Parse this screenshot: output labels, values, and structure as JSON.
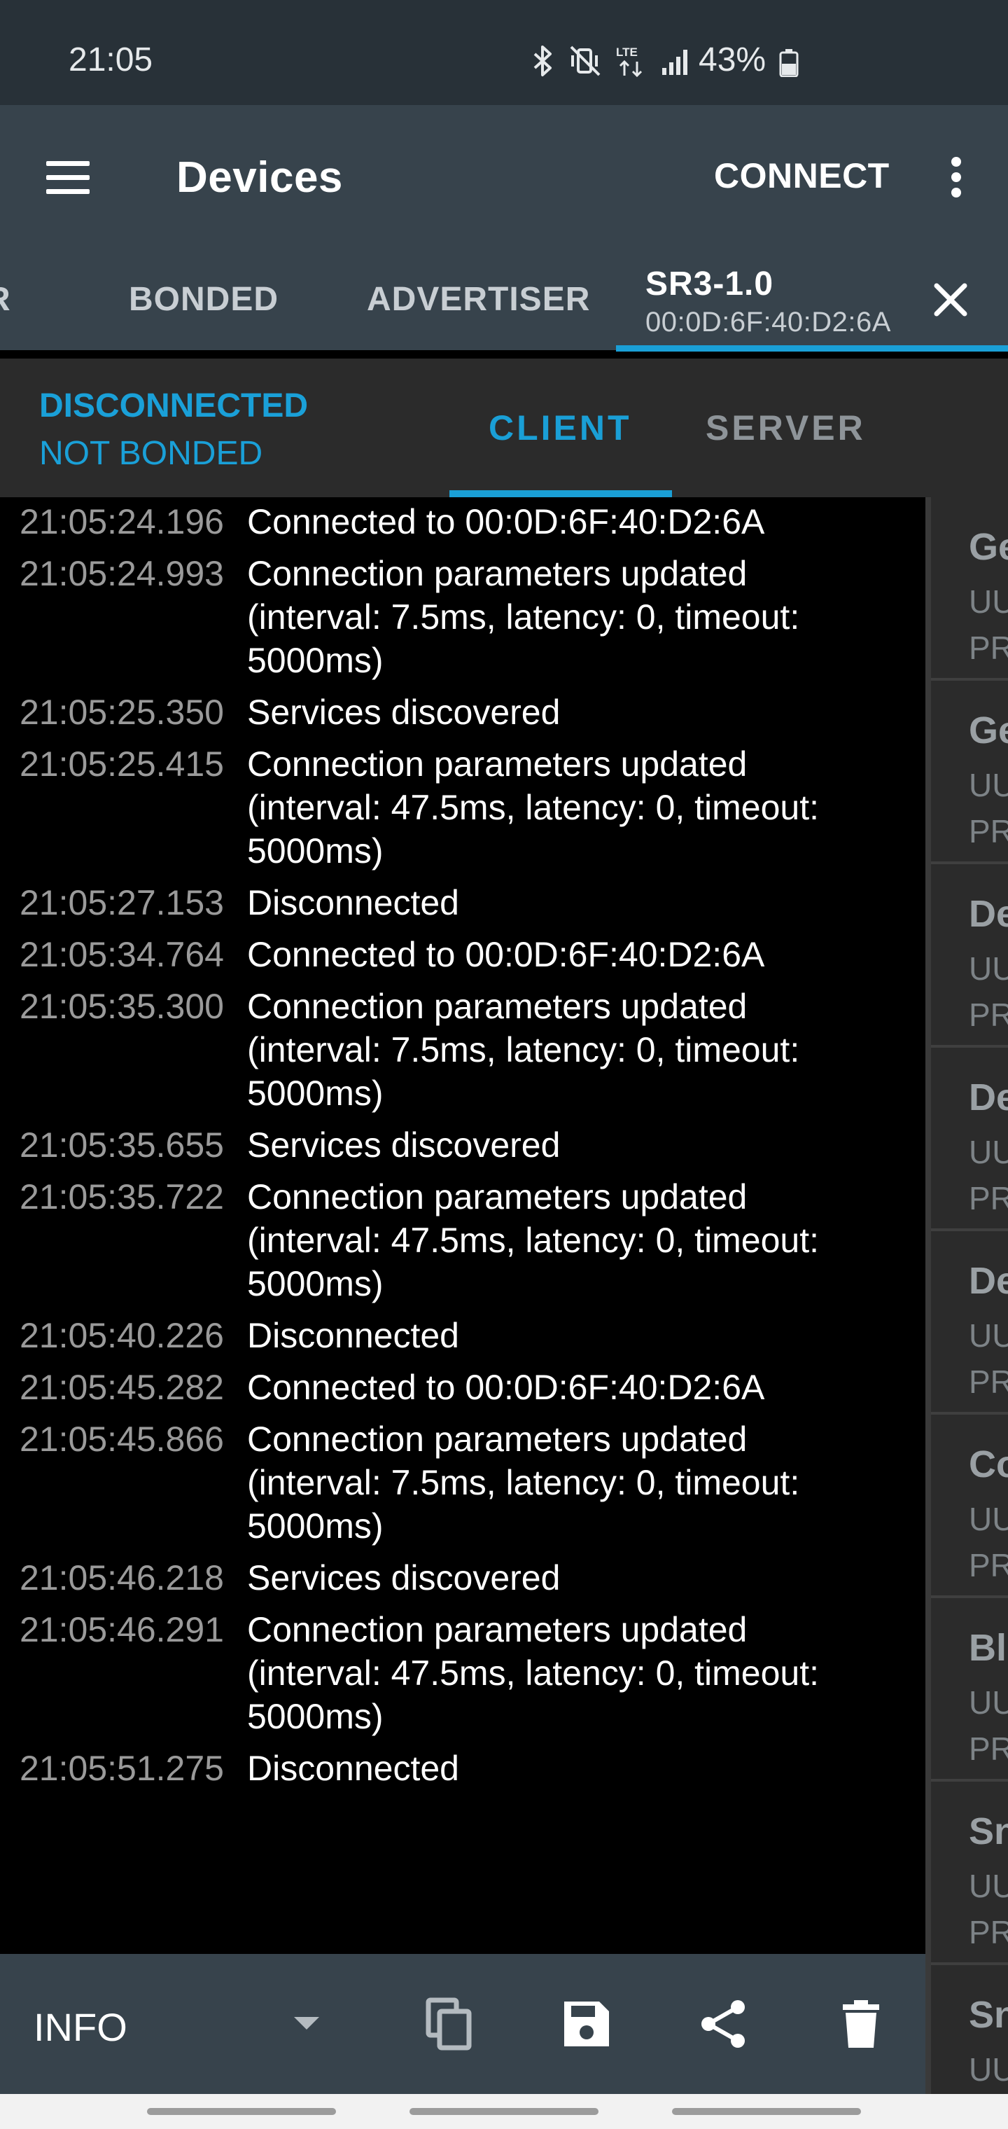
{
  "status_bar": {
    "time": "21:05",
    "network": "LTE",
    "battery_percent": "43%",
    "icons": [
      "bluetooth-icon",
      "vibrate-mute-icon",
      "lte-icon",
      "signal-icon",
      "battery-icon"
    ]
  },
  "app_bar": {
    "title": "Devices",
    "connect_label": "CONNECT"
  },
  "tabs": [
    {
      "label": "R"
    },
    {
      "label": "BONDED"
    },
    {
      "label": "ADVERTISER"
    }
  ],
  "device_tab": {
    "name": "SR3-1.0",
    "address": "00:0D:6F:40:D2:6A"
  },
  "connection": {
    "state": "DISCONNECTED",
    "bond_state": "NOT BONDED",
    "tabs": [
      "CLIENT",
      "SERVER"
    ]
  },
  "log": [
    {
      "time": "21:05:24.196",
      "message": "Connected to 00:0D:6F:40:D2:6A"
    },
    {
      "time": "21:05:24.993",
      "message": "Connection parameters updated (interval: 7.5ms, latency: 0, timeout: 5000ms)"
    },
    {
      "time": "21:05:25.350",
      "message": "Services discovered"
    },
    {
      "time": "21:05:25.415",
      "message": "Connection parameters updated (interval: 47.5ms, latency: 0, timeout: 5000ms)"
    },
    {
      "time": "21:05:27.153",
      "message": "Disconnected"
    },
    {
      "time": "21:05:34.764",
      "message": "Connected to 00:0D:6F:40:D2:6A"
    },
    {
      "time": "21:05:35.300",
      "message": "Connection parameters updated (interval: 7.5ms, latency: 0, timeout: 5000ms)"
    },
    {
      "time": "21:05:35.655",
      "message": "Services discovered"
    },
    {
      "time": "21:05:35.722",
      "message": "Connection parameters updated (interval: 47.5ms, latency: 0, timeout: 5000ms)"
    },
    {
      "time": "21:05:40.226",
      "message": "Disconnected"
    },
    {
      "time": "21:05:45.282",
      "message": "Connected to 00:0D:6F:40:D2:6A"
    },
    {
      "time": "21:05:45.866",
      "message": "Connection parameters updated (interval: 7.5ms, latency: 0, timeout: 5000ms)"
    },
    {
      "time": "21:05:46.218",
      "message": "Services discovered"
    },
    {
      "time": "21:05:46.291",
      "message": "Connection parameters updated (interval: 47.5ms, latency: 0, timeout: 5000ms)"
    },
    {
      "time": "21:05:51.275",
      "message": "Disconnected"
    }
  ],
  "services": [
    {
      "name": "Ge",
      "uuid": "UU",
      "primary": "PR"
    },
    {
      "name": "Ge",
      "uuid": "UU",
      "primary": "PR"
    },
    {
      "name": "De",
      "uuid": "UU",
      "primary": "PR"
    },
    {
      "name": "De",
      "uuid": "UU",
      "primary": "PR"
    },
    {
      "name": "De",
      "uuid": "UU",
      "primary": "PR"
    },
    {
      "name": "Co",
      "uuid": "UU",
      "primary": "PR"
    },
    {
      "name": "Bl",
      "uuid": "UU",
      "primary": "PR"
    },
    {
      "name": "Sn",
      "uuid": "UU",
      "primary": "PR"
    },
    {
      "name": "Sn",
      "uuid": "UU",
      "primary": ""
    }
  ],
  "log_toolbar": {
    "level": "INFO",
    "buttons": [
      "copy-icon",
      "save-icon",
      "share-icon",
      "delete-icon"
    ]
  },
  "colors": {
    "accent": "#1a9fd6",
    "toolbar": "#37434c",
    "status_bar": "#283138",
    "panel": "#2b2b2b"
  }
}
